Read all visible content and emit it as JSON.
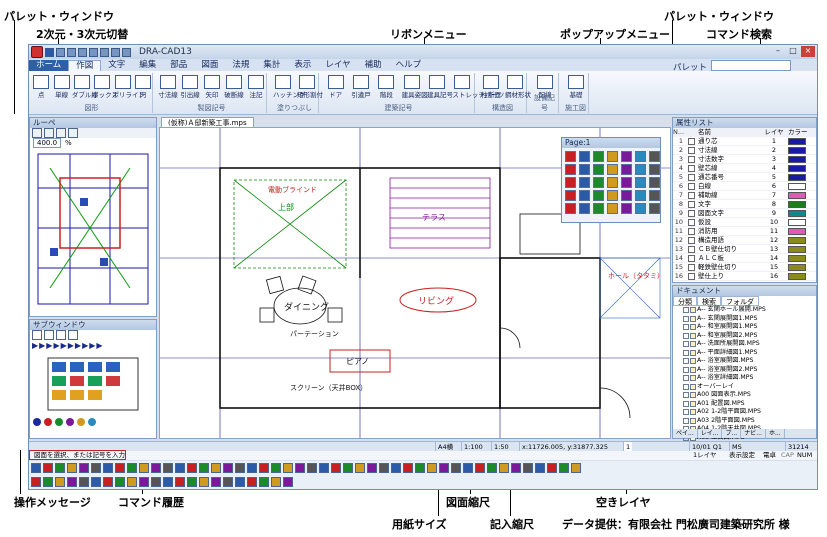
{
  "callouts": {
    "palette_window_left": "パレット・ウィンドウ",
    "dim_switch": "2次元・3次元切替",
    "ribbon_menu": "リボンメニュー",
    "popup_menu": "ポップアップメニュー",
    "palette_window_right": "パレット・ウィンドウ",
    "command_search": "コマンド検索",
    "operation_message": "操作メッセージ",
    "command_history": "コマンド履歴",
    "drawing_scale": "図面縮尺",
    "paper_size": "用紙サイズ",
    "entry_scale": "記入縮尺",
    "empty_layer": "空きレイヤ",
    "data_credit": "データ提供：有限会社 門松廣司建築研究所 様"
  },
  "app": {
    "title": "DRA-CAD13",
    "tabs": [
      "ホーム",
      "作図",
      "文字",
      "編集",
      "部品",
      "図面",
      "法規",
      "集計",
      "表示",
      "レイヤ",
      "補助",
      "ヘルプ"
    ],
    "active_tab": "作図",
    "palette_label": "パレット",
    "command_search_placeholder": "",
    "ribbon_groups": [
      {
        "label": "図形",
        "buttons": [
          "点",
          "単線",
          "ダブル線",
          "ボックス",
          "ポリライン",
          "円"
        ]
      },
      {
        "label": "製図記号",
        "buttons": [
          "寸法線",
          "引出線",
          "矢印",
          "破断線",
          "注記"
        ]
      },
      {
        "label": "塗りつぶし",
        "buttons": [
          "ハッチング",
          "矩形割付"
        ]
      },
      {
        "label": "建築記号",
        "buttons": [
          "ドア",
          "引違戸",
          "階段",
          "建具姿図",
          "建具記号",
          "ストレッチパーツ"
        ]
      },
      {
        "label": "構造図",
        "buttons": [
          "柱断面",
          "鋼材形状"
        ]
      },
      {
        "label": "設備記号",
        "buttons": [
          "配線"
        ]
      },
      {
        "label": "施工図",
        "buttons": [
          "基礎"
        ]
      }
    ]
  },
  "panels": {
    "loupe_title": "ルーペ",
    "loupe_zoom": "400.0",
    "loupe_unit": "%",
    "subwindow_title": "サブウィンドウ",
    "document_tab": "(仮称)Ａ邸新築工事.mps",
    "popup_title": "Page:1",
    "layer_list_title": "属性リスト",
    "layer_headers": [
      "N...",
      "名前",
      "レイヤ",
      "カラー"
    ],
    "layers": [
      {
        "no": "1",
        "name": "通り芯",
        "layer": "1",
        "color": "#1a1aa8"
      },
      {
        "no": "2",
        "name": "寸法線",
        "layer": "2",
        "color": "#1a1aa8"
      },
      {
        "no": "3",
        "name": "寸法数字",
        "layer": "3",
        "color": "#1a1aa8"
      },
      {
        "no": "4",
        "name": "壁芯線",
        "layer": "4",
        "color": "#1a1aa8"
      },
      {
        "no": "5",
        "name": "通芯番号",
        "layer": "5",
        "color": "#1a1aa8"
      },
      {
        "no": "6",
        "name": "白線",
        "layer": "6",
        "color": "#ffffff"
      },
      {
        "no": "7",
        "name": "補助線",
        "layer": "7",
        "color": "#e05ab8"
      },
      {
        "no": "8",
        "name": "文字",
        "layer": "8",
        "color": "#1d7a1d"
      },
      {
        "no": "9",
        "name": "図面文字",
        "layer": "9",
        "color": "#0a8a8a"
      },
      {
        "no": "10",
        "name": "仮設",
        "layer": "10",
        "color": "#ffffff"
      },
      {
        "no": "11",
        "name": "消防用",
        "layer": "11",
        "color": "#e05ab8"
      },
      {
        "no": "12",
        "name": "構造用語",
        "layer": "12",
        "color": "#8a8a1d"
      },
      {
        "no": "13",
        "name": "ＣＢ壁仕切り",
        "layer": "13",
        "color": "#8a8a1d"
      },
      {
        "no": "14",
        "name": "ＡＬＣ板",
        "layer": "14",
        "color": "#8a8a1d"
      },
      {
        "no": "15",
        "name": "軽鉄壁仕切り",
        "layer": "15",
        "color": "#8a8a1d"
      },
      {
        "no": "16",
        "name": "壁仕上り",
        "layer": "16",
        "color": "#8a8a1d"
      }
    ],
    "document_list_title": "ドキュメント",
    "document_tabs": [
      "分類",
      "検索",
      "フォルダ"
    ],
    "documents": [
      "A-- 玄関ホール展開.MPS",
      "A-- 玄関展開図1.MPS",
      "A-- 和室展開図1.MPS",
      "A-- 和室展開図2.MPS",
      "A-- 洗面所展開図.MPS",
      "A-- 平面詳細図1.MPS",
      "A-- 浴室展開図.MPS",
      "A-- 浴室展開図2.MPS",
      "A-- 浴室詳細図.MPS",
      "オーバーレイ",
      "A00 図面表示.MPS",
      "A01 配置図.MPS",
      "A02 1-2階平面図.MPS",
      "A03 2階平面図.MPS",
      "A04 1-2階天井図.MPS",
      "A05 立面図.MPS",
      "A06 断面図.MPS",
      "A07 矩計図.MPS"
    ],
    "bottom_tabs": [
      "ペイ...",
      "レイ...",
      "ブ...",
      "ナビ...",
      "ホ..."
    ]
  },
  "status": {
    "paper": "A4横",
    "drawing_scale": "1:100",
    "entry_scale": "1:50",
    "coords": "x:11726.005, y:31877.325",
    "layer_count": "1",
    "page_info": "10/01 Q1",
    "ms_label": "MS",
    "layer_label": "1レイヤ",
    "display_setting": "表示設定",
    "unit": "電卓",
    "caps": "CAP",
    "num": "NUM",
    "cap_value": "31214",
    "message": "図面を選択、または記号を入力"
  },
  "drawing_labels": {
    "dining": "ダイニング",
    "living": "リビング",
    "piano": "ピアノ",
    "terrace": "テラス",
    "up_label": "上部",
    "blinds": "電動ブラインド",
    "screen": "スクリーン（天井BOX）",
    "partition": "パーテーション",
    "hall": "ホール（タタミ）"
  }
}
